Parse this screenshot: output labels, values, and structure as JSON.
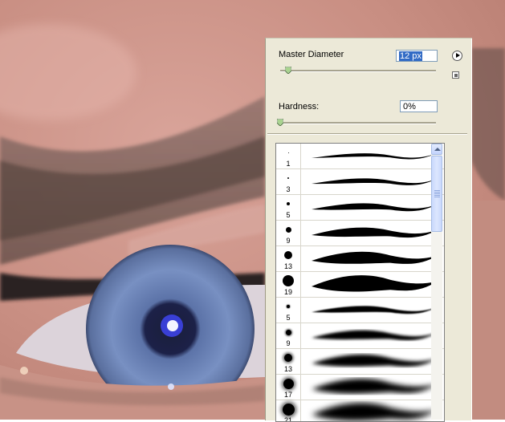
{
  "brush_panel": {
    "master_diameter_label": "Master Diameter",
    "master_diameter_value": "12 px",
    "master_diameter_slider_fraction": 0.05,
    "hardness_label": "Hardness:",
    "hardness_value": "0%",
    "hardness_slider_fraction": 0.0,
    "menu_icon": "play-arrow-icon",
    "reset_icon": "small-square-icon",
    "presets": [
      {
        "size": "1",
        "hard": true
      },
      {
        "size": "3",
        "hard": true
      },
      {
        "size": "5",
        "hard": true
      },
      {
        "size": "9",
        "hard": true
      },
      {
        "size": "13",
        "hard": true
      },
      {
        "size": "19",
        "hard": true
      },
      {
        "size": "5",
        "hard": false
      },
      {
        "size": "9",
        "hard": false
      },
      {
        "size": "13",
        "hard": false
      },
      {
        "size": "17",
        "hard": false
      },
      {
        "size": "21",
        "hard": false
      }
    ],
    "scrollbar_fraction": 0.0
  },
  "colors": {
    "panel_bg": "#ECE9D8",
    "selection": "#316AC5",
    "iris": "#6F86B8"
  }
}
